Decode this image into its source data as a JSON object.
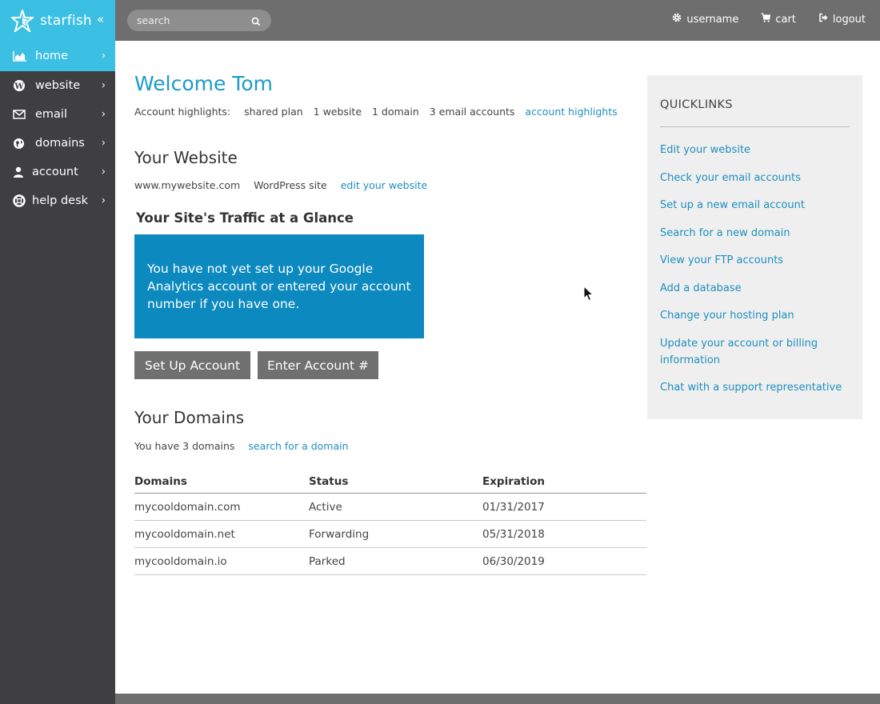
{
  "brand": {
    "name": "starfish",
    "collapse_glyph": "«",
    "accent": "#3bbfe3"
  },
  "sidebar": {
    "items": [
      {
        "label": "home",
        "icon": "area-chart-icon",
        "active": true
      },
      {
        "label": "website",
        "icon": "wordpress-icon"
      },
      {
        "label": "email",
        "icon": "envelope-icon"
      },
      {
        "label": "domains",
        "icon": "globe-icon"
      },
      {
        "label": "account",
        "icon": "user-icon"
      },
      {
        "label": "help desk",
        "icon": "life-ring-icon"
      }
    ]
  },
  "topbar": {
    "search_placeholder": "search",
    "username": "username",
    "cart": "cart",
    "logout": "logout"
  },
  "main": {
    "welcome": "Welcome Tom",
    "highlights": {
      "label": "Account highlights:",
      "plan": "shared plan",
      "websites": "1 website",
      "domains": "1 domain",
      "emails": "3 email accounts",
      "link": "account highlights"
    },
    "website": {
      "title": "Your Website",
      "url": "www.mywebsite.com",
      "type": "WordPress site",
      "edit_link": "edit your website"
    },
    "traffic": {
      "title": "Your Site's Traffic at a Glance",
      "message": "You have not yet set up your Google Analytics account or entered your account number if you have one.",
      "setup_button": "Set Up Account",
      "enter_button": "Enter Account #"
    },
    "domains": {
      "title": "Your Domains",
      "count_text": "You have 3 domains",
      "search_link": "search for a domain",
      "headers": [
        "Domains",
        "Status",
        "Expiration"
      ],
      "rows": [
        [
          "mycooldomain.com",
          "Active",
          "01/31/2017"
        ],
        [
          "mycooldomain.net",
          "Forwarding",
          "05/31/2018"
        ],
        [
          "mycooldomain.io",
          "Parked",
          "06/30/2019"
        ]
      ]
    }
  },
  "quicklinks": {
    "title": "QUICKLINKS",
    "items": [
      "Edit your website",
      "Check your email accounts",
      "Set up a new email account",
      "Search for a new domain",
      "View your FTP accounts",
      "Add a database",
      "Change your hosting plan",
      "Update your account or billing information",
      "Chat with a support representative"
    ]
  }
}
